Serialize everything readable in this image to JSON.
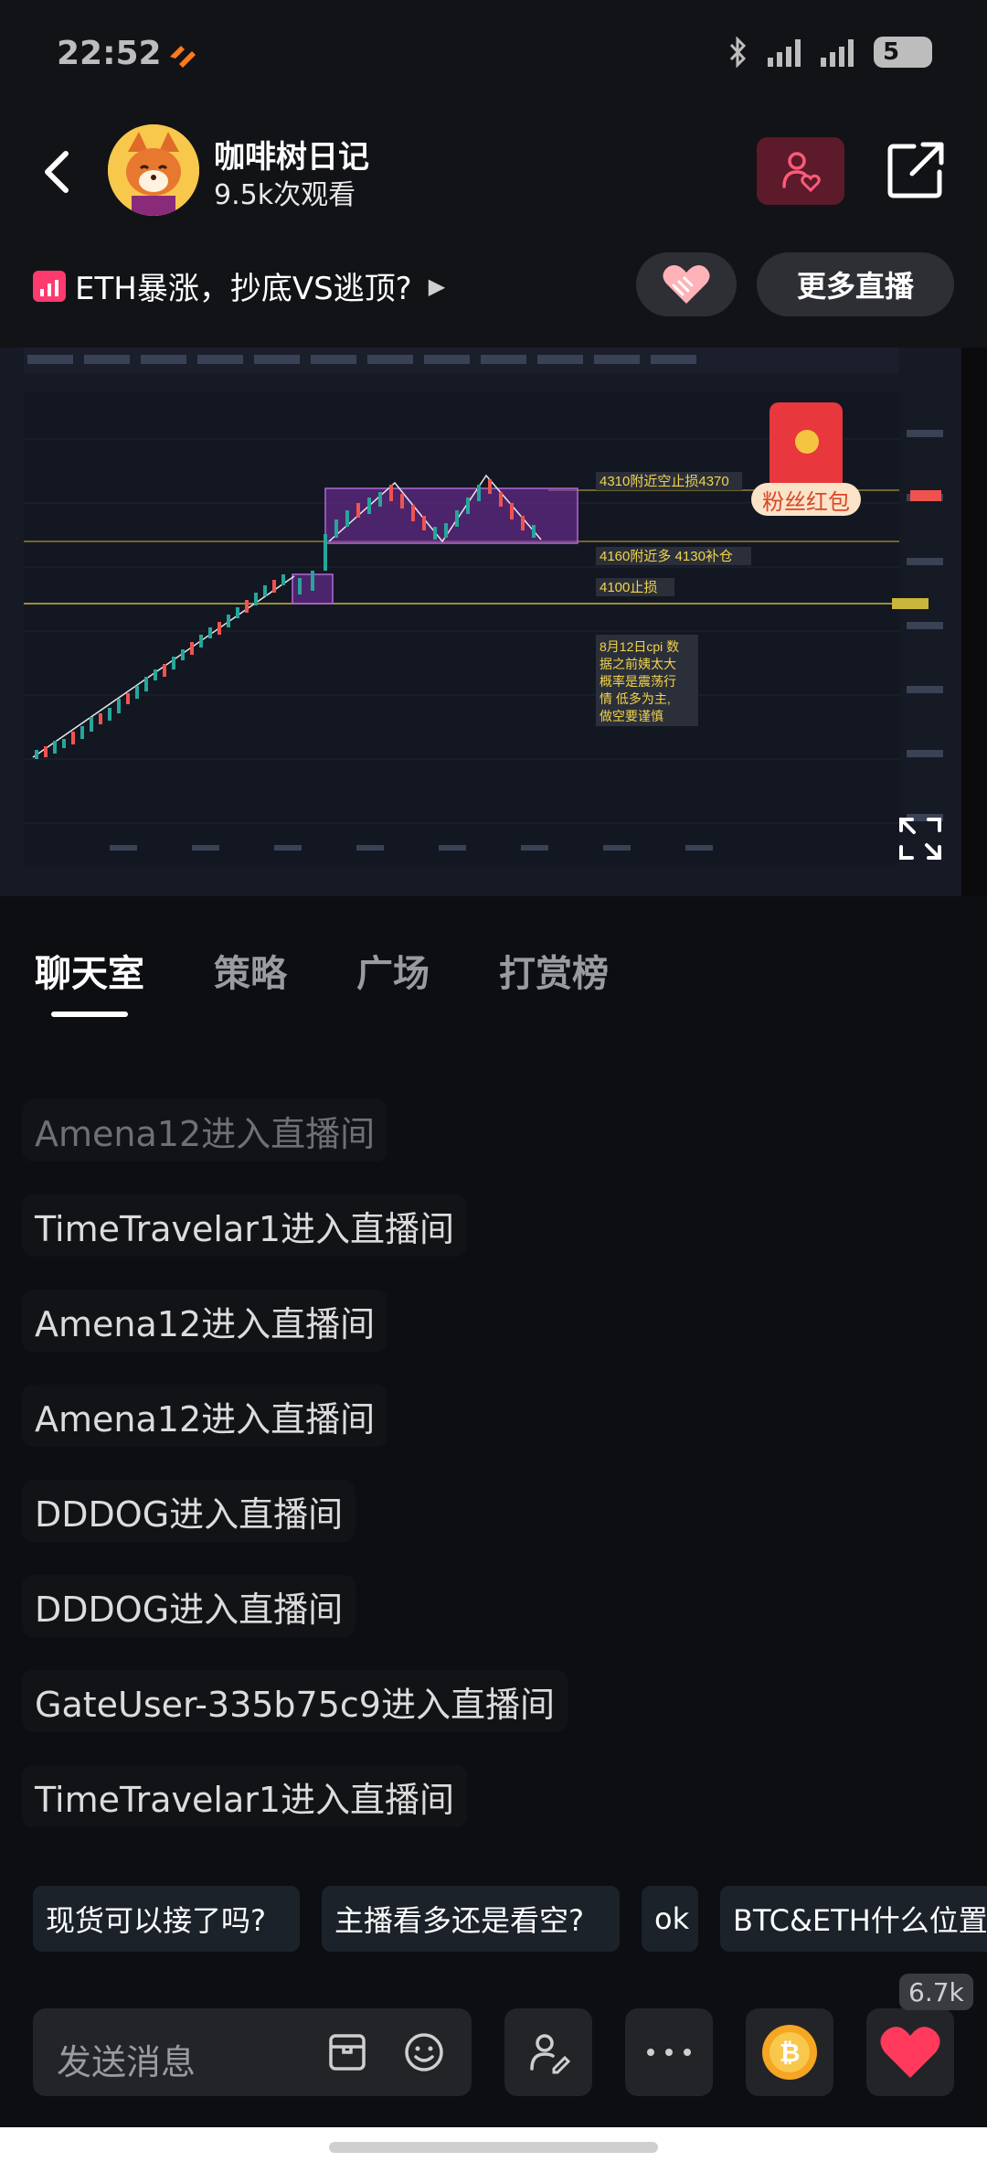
{
  "status_bar": {
    "time": "22:52",
    "battery": "5"
  },
  "header": {
    "host_name": "咖啡树日记",
    "views": "9.5k次观看",
    "topic": "ETH暴涨，抄底VS逃顶?",
    "more_live_label": "更多直播"
  },
  "video": {
    "annotations": {
      "short_zone": "4310附近空止损4370",
      "long_zone": "4160附近多 4130补仓",
      "stop_loss": "4100止损",
      "note": [
        "8月12日cpi 数",
        "据之前姨太大",
        "概率是震荡行",
        "情 低多为主,",
        "做空要谨慎"
      ]
    },
    "red_packet_label": "粉丝红包"
  },
  "tabs": [
    {
      "label": "聊天室",
      "active": true
    },
    {
      "label": "策略",
      "active": false
    },
    {
      "label": "广场",
      "active": false
    },
    {
      "label": "打赏榜",
      "active": false
    }
  ],
  "chat": [
    "Amena12进入直播间",
    "TimeTravelar1进入直播间",
    "Amena12进入直播间",
    "Amena12进入直播间",
    "DDDOG进入直播间",
    "DDDOG进入直播间",
    "GateUser-335b75c9进入直播间",
    "TimeTravelar1进入直播间"
  ],
  "quick_replies": [
    "现货可以接了吗?",
    "主播看多还是看空?",
    "ok",
    "BTC&ETH什么位置"
  ],
  "input": {
    "placeholder": "发送消息"
  },
  "like_count": "6.7k",
  "colors": {
    "accent_pink": "#ff3a6e",
    "follow_bg": "#5c1a2a",
    "gold": "#f5c542"
  }
}
